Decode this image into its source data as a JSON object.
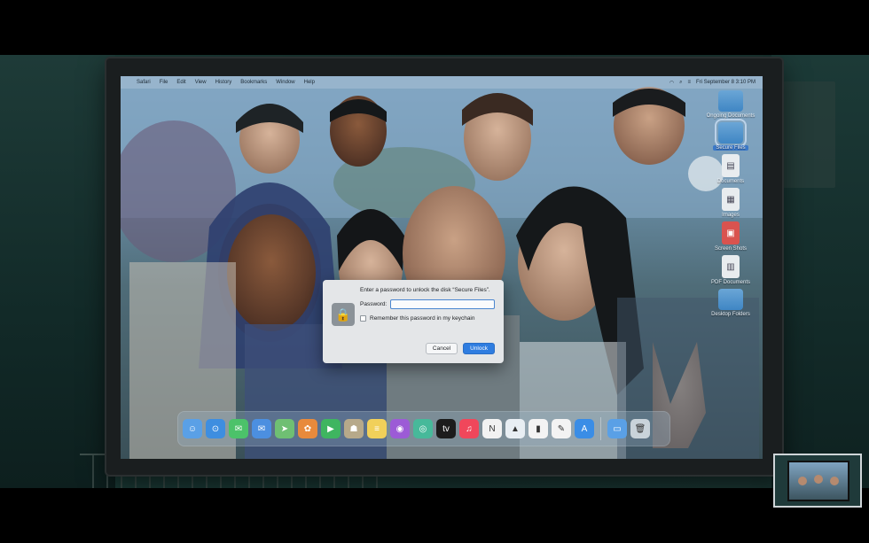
{
  "menubar": {
    "items": [
      "Safari",
      "File",
      "Edit",
      "View",
      "History",
      "Bookmarks",
      "Window",
      "Help"
    ],
    "clock": "Fri September 8 3:10 PM"
  },
  "desktop": {
    "items": [
      {
        "label": "Ongoing Documents",
        "icon": "folder-icon",
        "selected": false
      },
      {
        "label": "Secure Files",
        "icon": "folder-icon",
        "selected": true
      },
      {
        "label": "Documents",
        "icon": "document-icon",
        "selected": false
      },
      {
        "label": "Images",
        "icon": "image-icon",
        "selected": false
      },
      {
        "label": "Screen Shots",
        "icon": "screenshot-icon",
        "selected": false
      },
      {
        "label": "PDF Documents",
        "icon": "pdf-icon",
        "selected": false
      },
      {
        "label": "Desktop Folders",
        "icon": "folder-icon",
        "selected": false
      }
    ]
  },
  "dialog": {
    "message": "Enter a password to unlock the disk “Secure Files”.",
    "password_label": "Password:",
    "password_value": "",
    "remember_label": "Remember this password in my keychain",
    "cancel_label": "Cancel",
    "unlock_label": "Unlock"
  },
  "dock": {
    "apps": [
      {
        "name": "finder-icon",
        "color": "#5aa0e6",
        "glyph": "☺"
      },
      {
        "name": "safari-icon",
        "color": "#3e8ee0",
        "glyph": "⊙"
      },
      {
        "name": "messages-icon",
        "color": "#4cc26a",
        "glyph": "✉"
      },
      {
        "name": "mail-icon",
        "color": "#4c8fe0",
        "glyph": "✉"
      },
      {
        "name": "maps-icon",
        "color": "#6fbf73",
        "glyph": "➤"
      },
      {
        "name": "photos-icon",
        "color": "#e88a3c",
        "glyph": "✿"
      },
      {
        "name": "facetime-icon",
        "color": "#3fb560",
        "glyph": "▶"
      },
      {
        "name": "contacts-icon",
        "color": "#b7a98a",
        "glyph": "☗"
      },
      {
        "name": "notes-icon",
        "color": "#f1d05a",
        "glyph": "≡"
      },
      {
        "name": "podcasts-icon",
        "color": "#9c5bd6",
        "glyph": "◉"
      },
      {
        "name": "findmy-icon",
        "color": "#47b99a",
        "glyph": "◎"
      },
      {
        "name": "appletv-icon",
        "color": "#1c1c1c",
        "glyph": "tv"
      },
      {
        "name": "music-icon",
        "color": "#f0475b",
        "glyph": "♫"
      },
      {
        "name": "news-icon",
        "color": "#f2f2f2",
        "glyph": "N"
      },
      {
        "name": "keynote-icon",
        "color": "#e8eef3",
        "glyph": "▲"
      },
      {
        "name": "numbers-icon",
        "color": "#f3f3f3",
        "glyph": "▮"
      },
      {
        "name": "pages-icon",
        "color": "#f3f3f3",
        "glyph": "✎"
      },
      {
        "name": "appstore-icon",
        "color": "#3a8de6",
        "glyph": "A"
      }
    ],
    "trailing": [
      {
        "name": "downloads-folder-icon",
        "color": "#5aa0e6",
        "glyph": "▭"
      },
      {
        "name": "trash-icon",
        "color": "#c9d3da",
        "glyph": "🗑"
      }
    ]
  }
}
